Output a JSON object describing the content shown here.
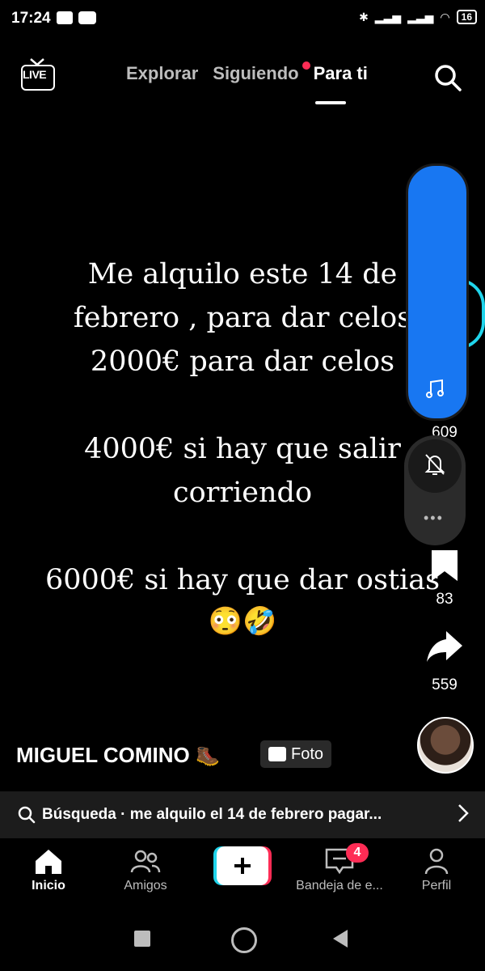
{
  "status_bar": {
    "time": "17:24",
    "battery": "16"
  },
  "top_nav": {
    "live_label": "LIVE",
    "tabs": [
      {
        "label": "Explorar",
        "active": false
      },
      {
        "label": "Siguiendo",
        "active": false,
        "has_dot": true
      },
      {
        "label": "Para ti",
        "active": true
      }
    ]
  },
  "post": {
    "lines": [
      "Me alquilo este 14 de",
      "febrero , para dar celos",
      "2000€ para dar celos",
      "",
      "4000€ si hay que salir",
      "corriendo",
      "",
      "6000€ si hay que dar ostias"
    ],
    "emoji": "😳🤣"
  },
  "side_actions": {
    "sound_count": "609",
    "bookmark_count": "83",
    "share_count": "559"
  },
  "author": {
    "name": "MIGUEL COMINO",
    "emoji": "🥾",
    "badge": "Foto"
  },
  "search_bar": {
    "text": "Búsqueda · me alquilo el 14 de febrero pagar..."
  },
  "bottom_nav": {
    "items": [
      {
        "label": "Inicio",
        "active": true
      },
      {
        "label": "Amigos",
        "active": false
      },
      {
        "label": "",
        "active": false
      },
      {
        "label": "Bandeja de e...",
        "active": false,
        "badge": "4"
      },
      {
        "label": "Perfil",
        "active": false
      }
    ]
  },
  "colors": {
    "accent": "#fe2c55",
    "panel_blue": "#1877f2",
    "cyan": "#20d5ec"
  },
  "icons": [
    "live-icon",
    "search-icon",
    "music-icon",
    "bell-off-icon",
    "bookmark-icon",
    "share-icon",
    "home-icon",
    "friends-icon",
    "plus-icon",
    "inbox-icon",
    "profile-icon"
  ]
}
